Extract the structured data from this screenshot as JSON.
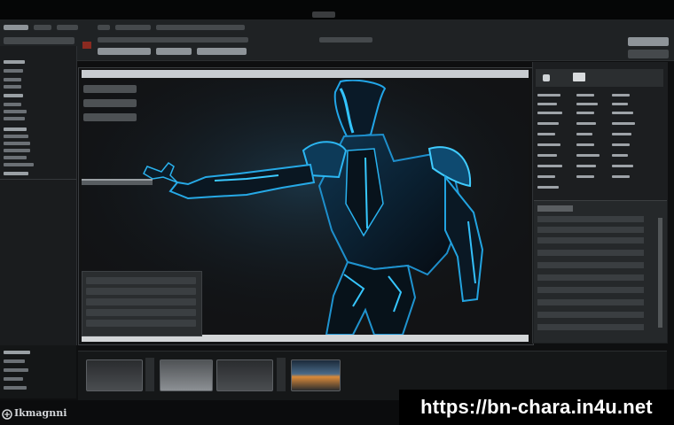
{
  "app": {
    "logo_text": "Ikmagnni"
  },
  "watermark": {
    "text": "https://bn-chara.in4u.net"
  },
  "viewport": {
    "subject": "cyber-armored-figure"
  },
  "colors": {
    "accent": "#22a6e8",
    "background": "#0e0f10",
    "panel": "#1c1e20"
  },
  "icons": [
    "window-controls-icon",
    "toolbar-tool-icon",
    "close-icon",
    "camera-icon"
  ]
}
